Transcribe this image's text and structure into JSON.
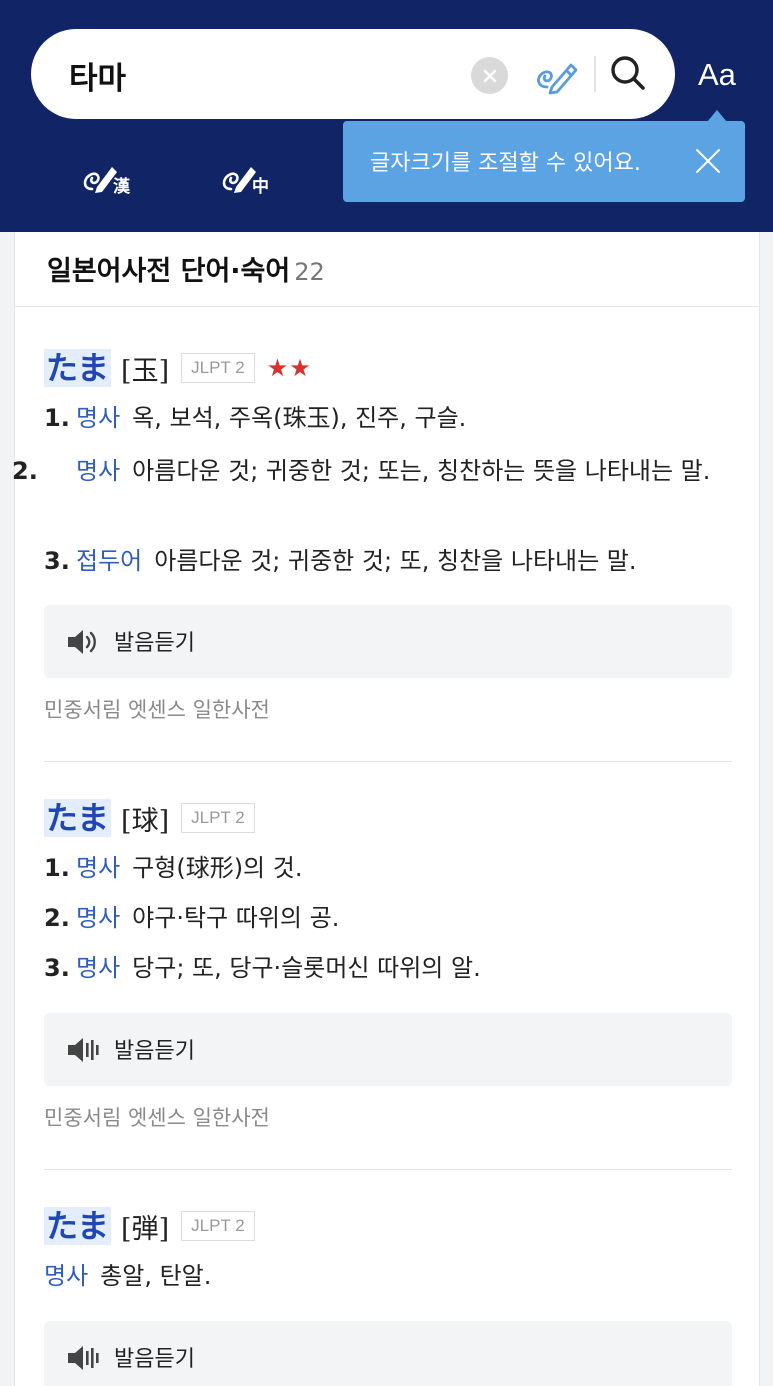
{
  "search": {
    "query": "타마",
    "font_size_button": "Aa"
  },
  "tooltip": {
    "text": "글자크기를 조절할 수 있어요."
  },
  "section": {
    "title": "일본어사전 단어·숙어",
    "count": "22"
  },
  "entries": [
    {
      "kana": "たま",
      "kanji": "[玉]",
      "jlpt": "JLPT 2",
      "stars": "★★",
      "senses": [
        {
          "num": "1.",
          "pos": "명사",
          "text": "옥, 보석, 주옥(珠玉), 진주, 구슬."
        },
        {
          "num": "2.",
          "pos": "명사",
          "text": "아름다운 것; 귀중한 것; 또는, 칭찬하는 뜻을 나타내는 말."
        },
        {
          "num": "3.",
          "pos": "접두어",
          "text": "아름다운 것; 귀중한 것; 또, 칭찬을 나타내는 말."
        }
      ],
      "audio_label": "발음듣기",
      "source": "민중서림 엣센스 일한사전"
    },
    {
      "kana": "たま",
      "kanji": "[球]",
      "jlpt": "JLPT 2",
      "senses": [
        {
          "num": "1.",
          "pos": "명사",
          "text": "구형(球形)의 것."
        },
        {
          "num": "2.",
          "pos": "명사",
          "text": "야구·탁구 따위의 공."
        },
        {
          "num": "3.",
          "pos": "명사",
          "text": "당구; 또, 당구·슬롯머신 따위의 알."
        }
      ],
      "audio_label": "발음듣기",
      "source": "민중서림 엣센스 일한사전"
    },
    {
      "kana": "たま",
      "kanji": "[弾]",
      "jlpt": "JLPT 2",
      "senses": [
        {
          "pos": "명사",
          "text": "총알, 탄알."
        }
      ],
      "audio_label": "발음듣기"
    }
  ],
  "colors": {
    "header_bg": "#102466",
    "tooltip_bg": "#5ba3e3",
    "kana": "#1f47b4",
    "pos": "#2f5fb8",
    "star": "#d8322c"
  },
  "icons": [
    "clear-icon",
    "handwriting-icon",
    "search-icon",
    "hanja-handwriting-icon",
    "chinese-handwriting-icon",
    "close-icon",
    "speaker-icon"
  ]
}
